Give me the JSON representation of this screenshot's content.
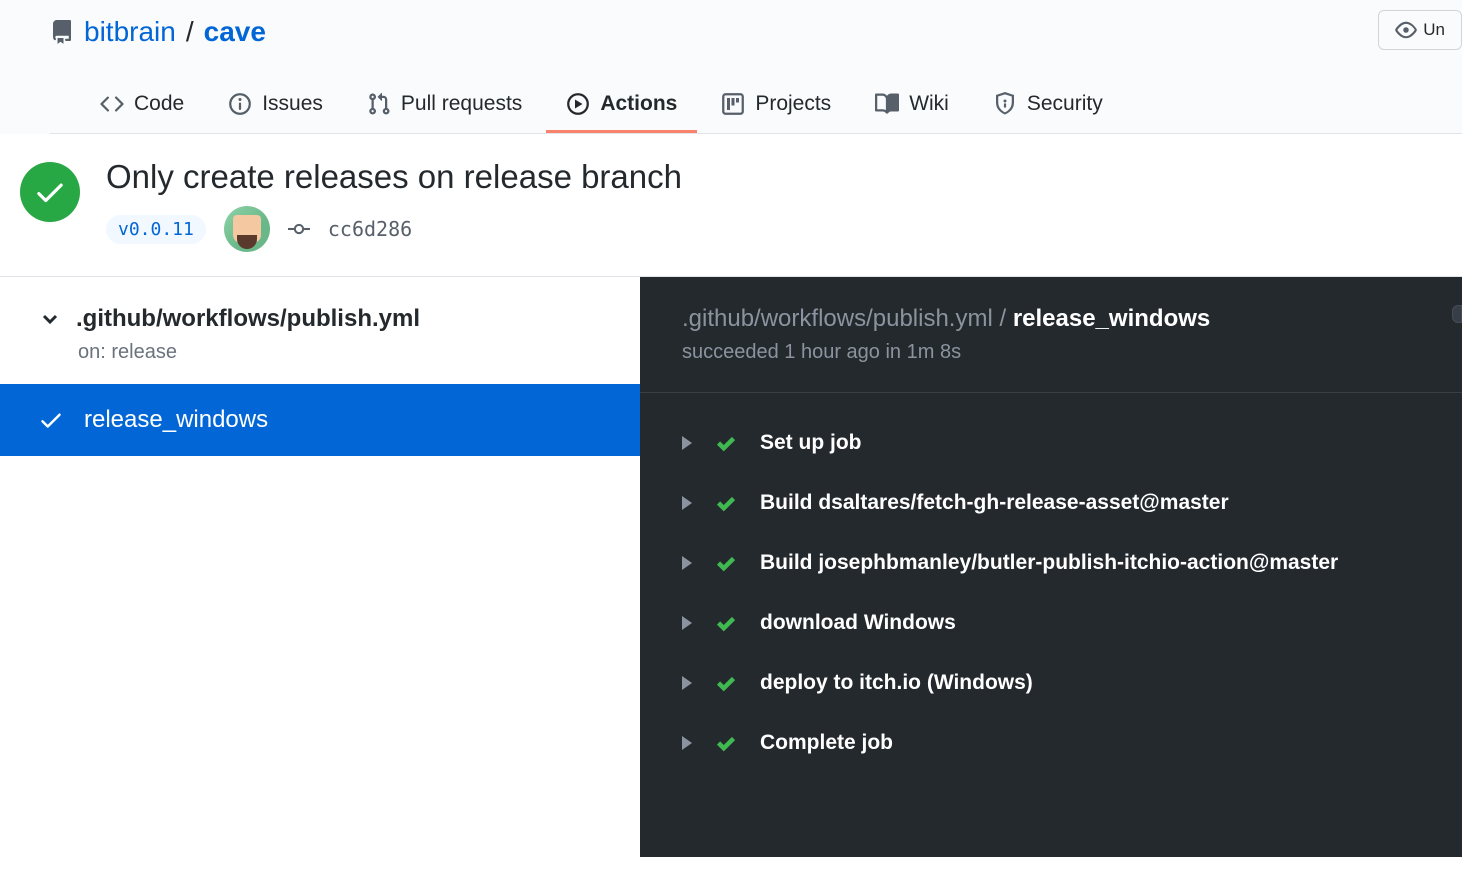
{
  "repo": {
    "owner": "bitbrain",
    "name": "cave"
  },
  "watch_label": "Un",
  "tabs": [
    {
      "label": "Code"
    },
    {
      "label": "Issues"
    },
    {
      "label": "Pull requests"
    },
    {
      "label": "Actions"
    },
    {
      "label": "Projects"
    },
    {
      "label": "Wiki"
    },
    {
      "label": "Security"
    }
  ],
  "run": {
    "title": "Only create releases on release branch",
    "tag": "v0.0.11",
    "sha": "cc6d286"
  },
  "workflow": {
    "path": ".github/workflows/publish.yml",
    "trigger": "on: release"
  },
  "job": {
    "name": "release_windows"
  },
  "log": {
    "crumb_path": ".github/workflows/publish.yml",
    "crumb_sep": " / ",
    "crumb_job": "release_windows",
    "status_line": "succeeded 1 hour ago in 1m 8s"
  },
  "steps": [
    {
      "name": "Set up job"
    },
    {
      "name": "Build dsaltares/fetch-gh-release-asset@master"
    },
    {
      "name": "Build josephbmanley/butler-publish-itchio-action@master"
    },
    {
      "name": "download Windows"
    },
    {
      "name": "deploy to itch.io (Windows)"
    },
    {
      "name": "Complete job"
    }
  ]
}
